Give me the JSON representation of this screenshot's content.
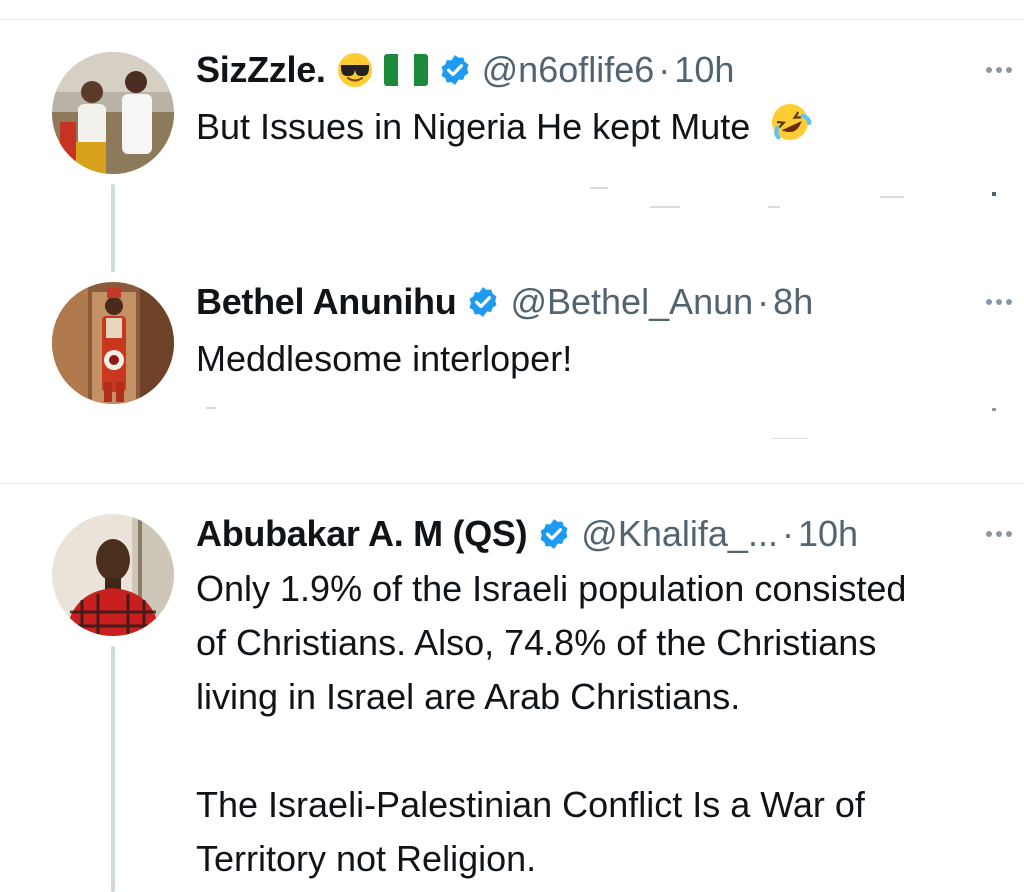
{
  "tweets": [
    {
      "name": "SizZzle.",
      "handle": "@n6oflife6",
      "separator": "·",
      "time": "10h",
      "text": "But Issues in Nigeria He kept Mute",
      "icons": [
        "sunglasses-emoji",
        "nigeria-flag",
        "verified-badge",
        "rofl-emoji",
        "more-icon"
      ]
    },
    {
      "name": "Bethel Anunihu",
      "handle": "@Bethel_Anun",
      "separator": "·",
      "time": "8h",
      "text": "Meddlesome interloper!",
      "icons": [
        "verified-badge",
        "more-icon"
      ]
    },
    {
      "name": "Abubakar A. M (QS)",
      "handle": "@Khalifa_...",
      "separator": "·",
      "time": "10h",
      "text_lines": [
        "Only 1.9% of the Israeli population consisted",
        "of Christians. Also, 74.8% of the Christians",
        "living in Israel are Arab Christians.",
        "",
        "The Israeli-Palestinian Conflict Is a War of",
        "Territory not Religion."
      ],
      "icons": [
        "verified-badge",
        "more-icon"
      ]
    }
  ],
  "colors": {
    "text": "#0f1419",
    "secondary": "#536471",
    "verified": "#1d9bf0",
    "thread_line": "#cfd9de",
    "divider": "#e1e6ea"
  }
}
